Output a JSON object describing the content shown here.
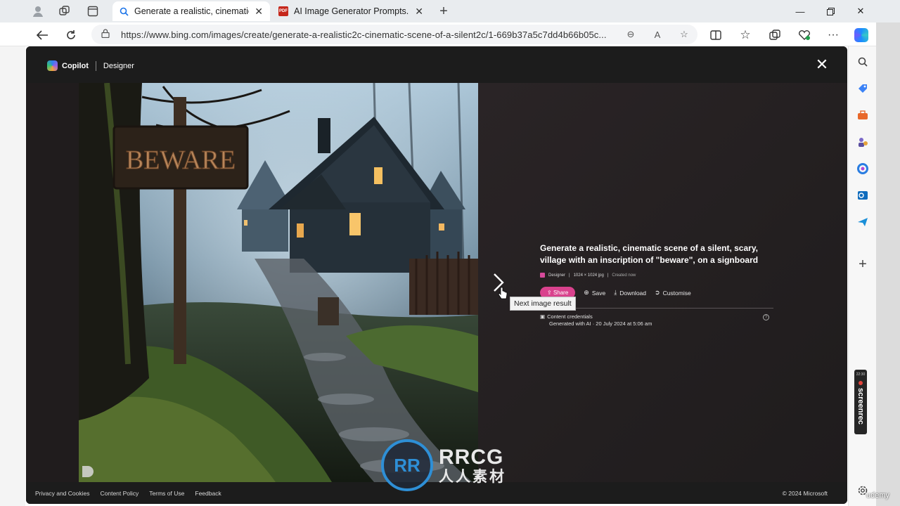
{
  "browser": {
    "tabs": [
      {
        "label": "Generate a realistic, cinematic sc",
        "active": true
      },
      {
        "label": "AI Image Generator Prompts.pdf",
        "active": false
      }
    ],
    "url": "https://www.bing.com/images/create/generate-a-realistic2c-cinematic-scene-of-a-silent2c/1-669b37a5c7dd4b66b05c..."
  },
  "designer": {
    "product": "Copilot",
    "app": "Designer",
    "image_sign_text": "BEWARE",
    "prompt": "Generate a realistic, cinematic scene of a silent, scary, village with an inscription of \"beware\", on a signboard",
    "meta": {
      "source": "Designer",
      "dimensions": "1024 × 1024 jpg",
      "created": "Created now"
    },
    "actions": {
      "share": "Share",
      "save": "Save",
      "download": "Download",
      "customise": "Customise"
    },
    "tooltip": "Next image result",
    "credentials": {
      "title": "Content credentials",
      "detail": "Generated with AI · 20 July 2024 at 5:06 am"
    },
    "footer": {
      "links": [
        "Privacy and Cookies",
        "Content Policy",
        "Terms of Use",
        "Feedback"
      ],
      "copyright": "© 2024 Microsoft"
    }
  },
  "overlay": {
    "watermark_line1": "RRCG",
    "watermark_line2": "人人素材",
    "screenrec_label": "screenrec",
    "screenrec_time": "22:30",
    "udemy": "udemy"
  },
  "colors": {
    "share": "#d9428d",
    "modal_bg": "#201c1d",
    "accent_blue": "#2e8fd6"
  }
}
